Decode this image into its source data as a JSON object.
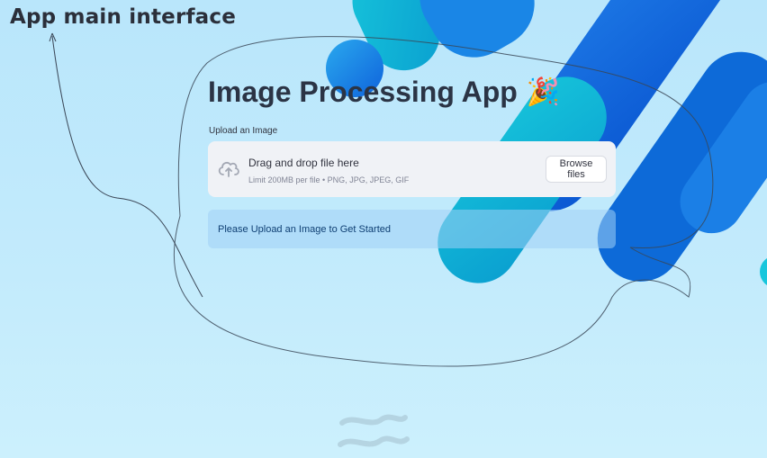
{
  "annotation": {
    "title": "App main interface"
  },
  "app": {
    "title": "Image Processing App",
    "title_emoji": "🎉",
    "upload_label": "Upload an Image",
    "dropzone": {
      "title": "Drag and drop file here",
      "limit": "Limit 200MB per file • PNG, JPG, JPEG, GIF",
      "browse_label": "Browse files",
      "icon": "cloud-upload-icon"
    },
    "info_message": "Please Upload an Image to Get Started"
  },
  "colors": {
    "background": "#bde8fb",
    "accent_blue": "#1f6fe0",
    "accent_cyan": "#14b9d6",
    "info_text": "#0f3f73"
  }
}
